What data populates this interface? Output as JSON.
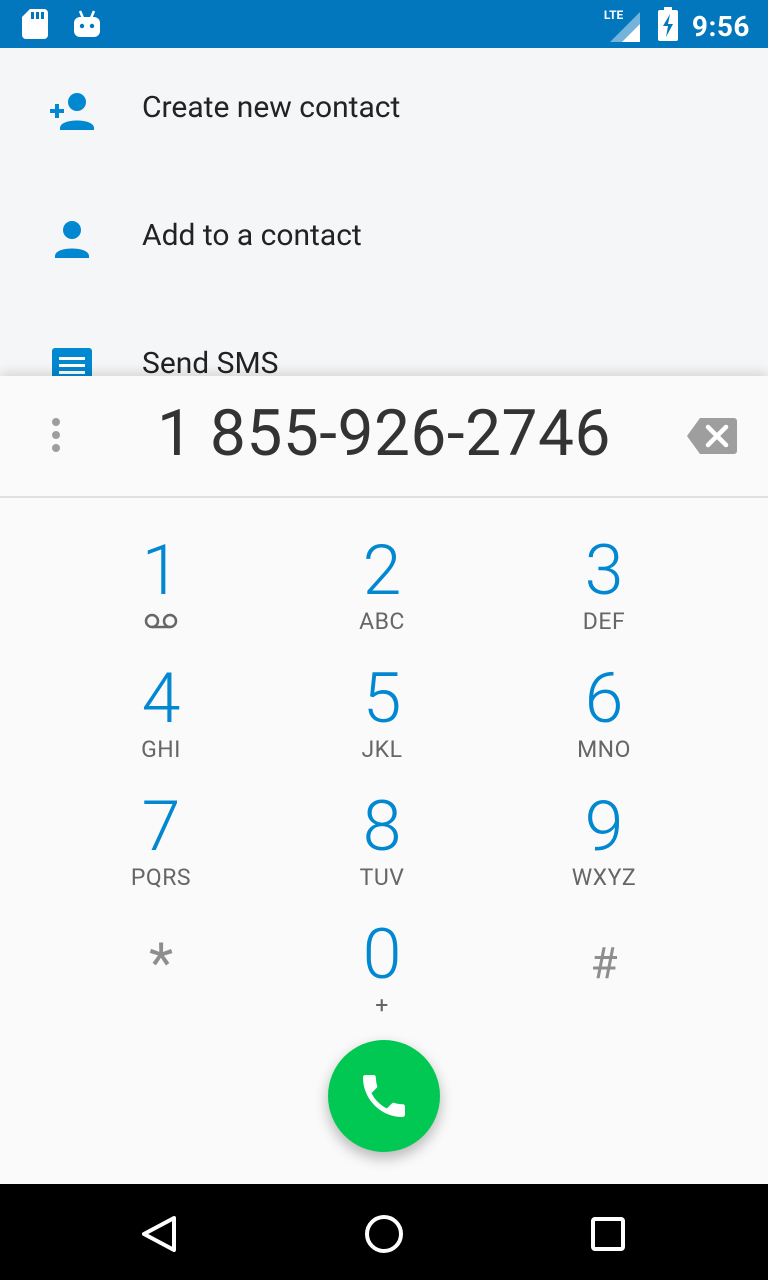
{
  "status_bar": {
    "network": "LTE",
    "time": "9:56",
    "icons": [
      "sd-card-icon",
      "android-icon",
      "lte-signal-icon",
      "battery-charging-icon"
    ]
  },
  "suggestions": [
    {
      "label": "Create new contact",
      "icon": "person-add-icon"
    },
    {
      "label": "Add to a contact",
      "icon": "person-icon"
    },
    {
      "label": "Send SMS",
      "icon": "message-icon"
    }
  ],
  "dialer": {
    "number": "1 855-926-2746",
    "keys": [
      {
        "digit": "1",
        "letters": "",
        "sub_icon": "voicemail-icon"
      },
      {
        "digit": "2",
        "letters": "ABC"
      },
      {
        "digit": "3",
        "letters": "DEF"
      },
      {
        "digit": "4",
        "letters": "GHI"
      },
      {
        "digit": "5",
        "letters": "JKL"
      },
      {
        "digit": "6",
        "letters": "MNO"
      },
      {
        "digit": "7",
        "letters": "PQRS"
      },
      {
        "digit": "8",
        "letters": "TUV"
      },
      {
        "digit": "9",
        "letters": "WXYZ"
      },
      {
        "digit": "*",
        "letters": ""
      },
      {
        "digit": "0",
        "letters": "+"
      },
      {
        "digit": "#",
        "letters": ""
      }
    ]
  },
  "colors": {
    "status_bar": "#0277bd",
    "accent": "#0288d1",
    "call_button": "#00c853"
  }
}
